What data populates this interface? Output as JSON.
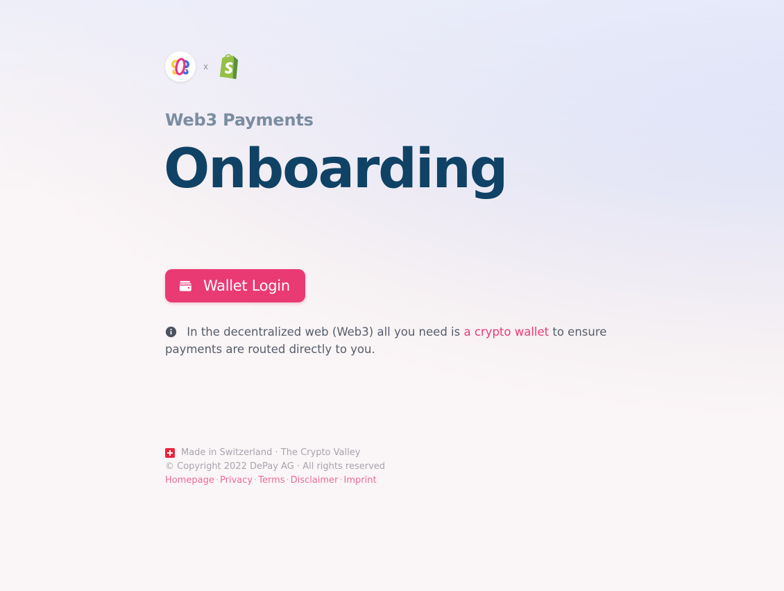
{
  "background": {
    "base_color": "#faf5f6",
    "accent_color": "#d2dbf8"
  },
  "brand": {
    "depay_logo_icon": "depay-logo-icon",
    "separator": "x",
    "shopify_logo_icon": "shopify-bag-icon",
    "depay_colors": {
      "ring": "#e9348a",
      "yellow": "#f9c846",
      "blue": "#3b6fd4",
      "badge_bg": "#ffffff"
    },
    "shopify_colors": {
      "bag_light": "#95bf47",
      "bag_dark": "#5e8e3e",
      "letter": "#ffffff"
    }
  },
  "header": {
    "eyebrow": "Web3 Payments",
    "title": "Onboarding",
    "eyebrow_color": "#7c8ca0",
    "title_color": "#104265"
  },
  "actions": {
    "wallet_login": {
      "label": "Wallet Login",
      "icon": "wallet-icon",
      "bg_color": "#ea3a74",
      "text_color": "#ffffff"
    }
  },
  "info": {
    "icon": "info-circle-icon",
    "text_before": "In the decentralized web (Web3) all you need is ",
    "link_text": "a crypto wallet",
    "text_after": " to ensure payments are routed directly to you.",
    "link_color": "#ea3a74"
  },
  "footer": {
    "flag_icon": "swiss-flag-icon",
    "made_in": "Made in Switzerland · The Crypto Valley",
    "copyright": "© Copyright 2022 DePay AG · All rights reserved",
    "links": [
      {
        "label": "Homepage"
      },
      {
        "label": "Privacy"
      },
      {
        "label": "Terms"
      },
      {
        "label": "Disclaimer"
      },
      {
        "label": "Imprint"
      }
    ],
    "separator": "·",
    "link_color": "#ee6c98",
    "text_color": "#a8a4ae"
  }
}
